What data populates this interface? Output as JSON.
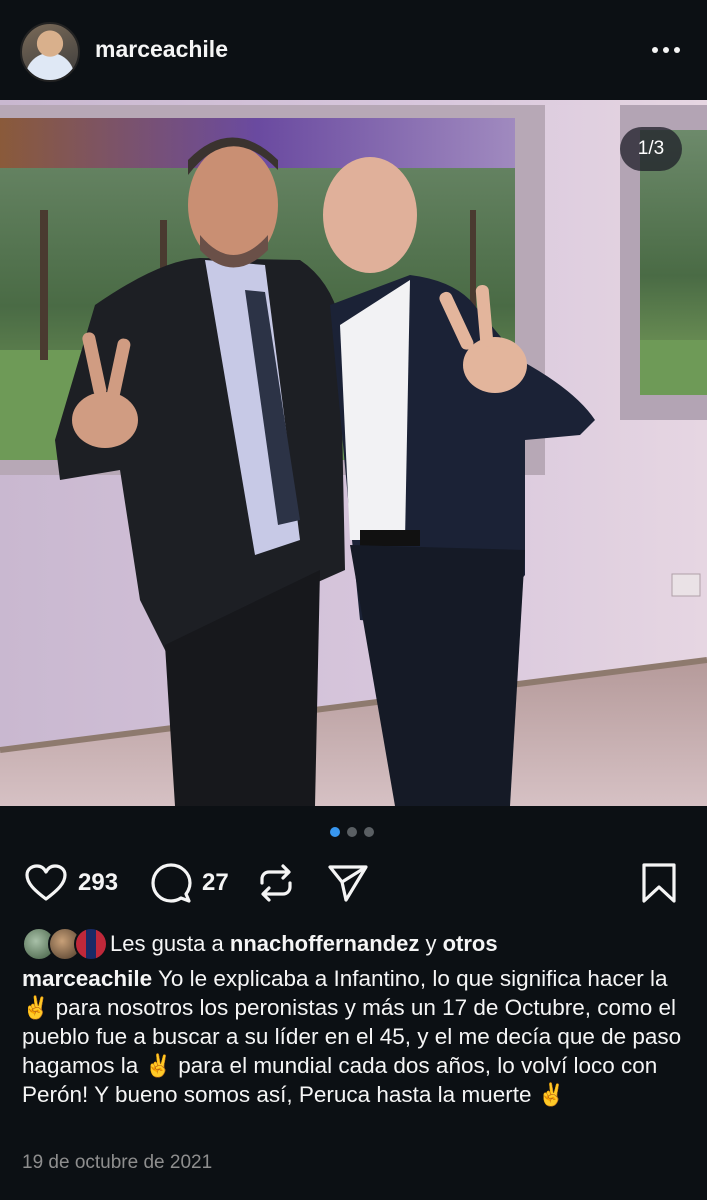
{
  "post": {
    "username": "marceachile",
    "image_counter": "1/3",
    "carousel": {
      "total": 3,
      "active": 0
    },
    "likes_count": "293",
    "comments_count": "27",
    "liked_by": {
      "prefix": "Les gusta a",
      "user": "nnachoffernandez",
      "connector": "y",
      "others": "otros"
    },
    "caption": {
      "user": "marceachile",
      "part1": "Yo le explicaba a Infantino, lo que significa hacer la",
      "part2": "para nosotros los peronistas y más un 17 de Octubre, como el pueblo fue a buscar a su líder en el 45, y el me decía que de paso hagamos la",
      "part3": "para el mundial cada dos años, lo volví loco con Perón! Y bueno somos así, Peruca hasta la muerte",
      "emoji": "✌️"
    },
    "date": "19 de octubre de 2021"
  },
  "colors": {
    "background": "#0c1014",
    "text": "#f5f5f5",
    "muted": "#8e8e8e",
    "active_dot": "#3897f0",
    "inactive_dot": "#5a5f63"
  },
  "icons": [
    "heart-icon",
    "comment-icon",
    "repost-icon",
    "share-icon",
    "bookmark-icon",
    "more-options-icon"
  ]
}
